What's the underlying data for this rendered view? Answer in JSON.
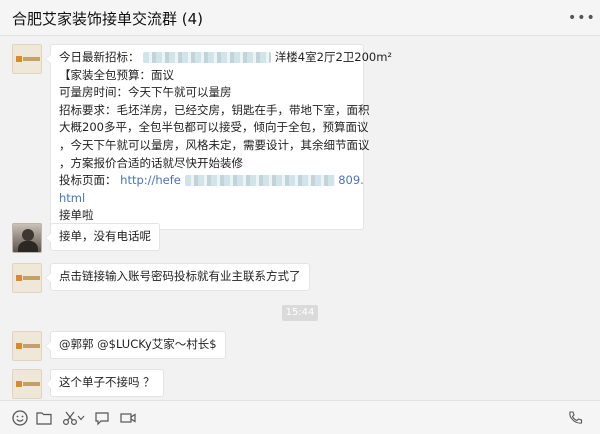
{
  "window": {
    "title": "合肥艾家装饰接单交流群 (4)",
    "more_icon": "more-dots-icon"
  },
  "messages": [
    {
      "avatar": "company-logo",
      "lines": [
        "今日最新招标：",
        "【家装全包预算：面议",
        "可量房时间：今天下午就可以量房",
        "招标要求：毛坯洋房，已经交房，钥匙在手，带地下室，面积",
        "大概200多平，全包半包都可以接受，倾向于全包，预算面议",
        "，今天下午就可以量房，风格未定，需要设计，其余细节面议",
        "，方案报价合适的话就尽快开始装修",
        "html",
        "接单啦"
      ],
      "line1_suffix": "洋楼4室2厅2卫200m²",
      "link_prefix_label": "投标页面：",
      "link_start": "http://hefe",
      "link_end": "809."
    },
    {
      "avatar": "user-photo",
      "text": "接单，没有电话呢"
    },
    {
      "avatar": "company-logo",
      "text": "点击链接输入账号密码投标就有业主联系方式了"
    },
    {
      "avatar": "company-logo",
      "text": "@郭郭 @$LUCKy艾家～村长$"
    },
    {
      "avatar": "company-logo",
      "text": "这个单子不接吗 ？"
    }
  ],
  "timestamp": "15:44",
  "toolbar": {
    "items": [
      "emoji-icon",
      "folder-icon",
      "scissors-icon",
      "chat-bubble-icon",
      "video-icon",
      "phone-icon"
    ]
  },
  "colors": {
    "background": "#f2f2f2",
    "bubble": "#ffffff",
    "link": "#4a74b8",
    "timestamp_bg": "#dadada"
  }
}
